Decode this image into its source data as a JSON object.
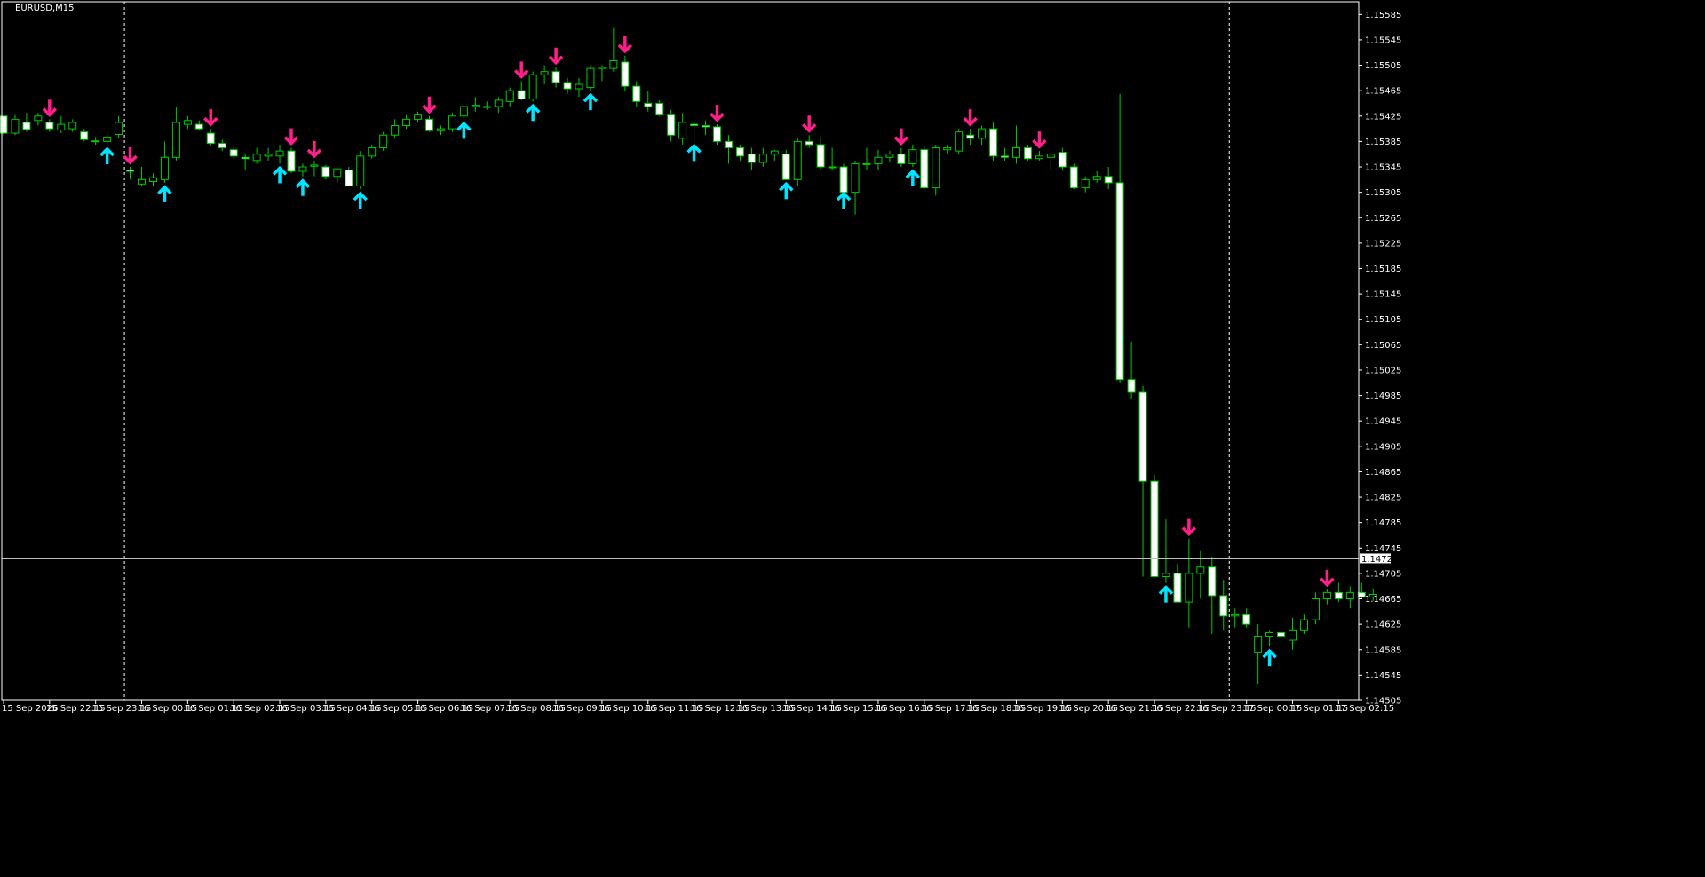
{
  "symbol_label": "EURUSD,M15",
  "current_price_label": "1.14728",
  "colors": {
    "background": "#000000",
    "candle_bull": "#000000",
    "candle_bear": "#ffffff",
    "candle_outline": "#00cc00",
    "wick": "#00cc00",
    "frame": "#ffffff",
    "text": "#ffffff",
    "arrow_buy": "#00e5ff",
    "arrow_sell": "#ff1f8a",
    "price_line": "#c0c0c0",
    "separator": "#ffffff"
  },
  "icons": {
    "buy_arrow": "arrow-up-icon",
    "sell_arrow": "arrow-down-icon"
  },
  "chart_data": {
    "type": "candlestick",
    "ylim": [
      1.14505,
      1.15605
    ],
    "y_ticks": [
      "1.15585",
      "1.15545",
      "1.15505",
      "1.15465",
      "1.15425",
      "1.15385",
      "1.15345",
      "1.15305",
      "1.15265",
      "1.15225",
      "1.15185",
      "1.15145",
      "1.15105",
      "1.15065",
      "1.15025",
      "1.14985",
      "1.14945",
      "1.14905",
      "1.14865",
      "1.14825",
      "1.14785",
      "1.14745",
      "1.14705",
      "1.14665",
      "1.14625",
      "1.14585",
      "1.14545",
      "1.14505"
    ],
    "x_ticks": [
      {
        "label": "15 Sep 2026",
        "bar": 0
      },
      {
        "label": "15 Sep 22:15",
        "bar": 4
      },
      {
        "label": "15 Sep 23:15",
        "bar": 8
      },
      {
        "label": "16 Sep 00:15",
        "bar": 12
      },
      {
        "label": "16 Sep 01:15",
        "bar": 16
      },
      {
        "label": "16 Sep 02:15",
        "bar": 20
      },
      {
        "label": "16 Sep 03:15",
        "bar": 24
      },
      {
        "label": "16 Sep 04:15",
        "bar": 28
      },
      {
        "label": "16 Sep 05:15",
        "bar": 32
      },
      {
        "label": "16 Sep 06:15",
        "bar": 36
      },
      {
        "label": "16 Sep 07:15",
        "bar": 40
      },
      {
        "label": "16 Sep 08:15",
        "bar": 44
      },
      {
        "label": "16 Sep 09:15",
        "bar": 48
      },
      {
        "label": "16 Sep 10:15",
        "bar": 52
      },
      {
        "label": "16 Sep 11:15",
        "bar": 56
      },
      {
        "label": "16 Sep 12:15",
        "bar": 60
      },
      {
        "label": "16 Sep 13:15",
        "bar": 64
      },
      {
        "label": "16 Sep 14:15",
        "bar": 68
      },
      {
        "label": "16 Sep 15:15",
        "bar": 72
      },
      {
        "label": "16 Sep 16:15",
        "bar": 76
      },
      {
        "label": "16 Sep 17:15",
        "bar": 80
      },
      {
        "label": "16 Sep 18:15",
        "bar": 84
      },
      {
        "label": "16 Sep 19:15",
        "bar": 88
      },
      {
        "label": "16 Sep 20:15",
        "bar": 92
      },
      {
        "label": "16 Sep 21:15",
        "bar": 96
      },
      {
        "label": "16 Sep 22:15",
        "bar": 100
      },
      {
        "label": "16 Sep 23:15",
        "bar": 104
      },
      {
        "label": "17 Sep 00:15",
        "bar": 108
      },
      {
        "label": "17 Sep 01:15",
        "bar": 112
      },
      {
        "label": "17 Sep 02:15",
        "bar": 116
      }
    ],
    "day_separators": [
      11,
      107
    ],
    "current_price": 1.14728,
    "ohlc": [
      [
        1.15425,
        1.15425,
        1.15395,
        1.15398
      ],
      [
        1.15398,
        1.15428,
        1.15395,
        1.1542
      ],
      [
        1.15415,
        1.1543,
        1.154,
        1.15404
      ],
      [
        1.15418,
        1.1543,
        1.1541,
        1.15425
      ],
      [
        1.15415,
        1.1542,
        1.154,
        1.15405
      ],
      [
        1.15403,
        1.15425,
        1.15398,
        1.15412
      ],
      [
        1.15405,
        1.1542,
        1.154,
        1.15415
      ],
      [
        1.154,
        1.15405,
        1.15385,
        1.15388
      ],
      [
        1.15386,
        1.15392,
        1.1538,
        1.15385
      ],
      [
        1.15385,
        1.154,
        1.1538,
        1.15392
      ],
      [
        1.15396,
        1.15425,
        1.1539,
        1.15415
      ],
      [
        1.1534,
        1.15345,
        1.15325,
        1.15338
      ],
      [
        1.15318,
        1.15345,
        1.15315,
        1.15325
      ],
      [
        1.15322,
        1.15335,
        1.15315,
        1.15328
      ],
      [
        1.15325,
        1.15385,
        1.1532,
        1.1536
      ],
      [
        1.1536,
        1.1544,
        1.15355,
        1.15415
      ],
      [
        1.15412,
        1.15425,
        1.15405,
        1.15418
      ],
      [
        1.15412,
        1.15418,
        1.15402,
        1.15405
      ],
      [
        1.15398,
        1.15405,
        1.15378,
        1.15382
      ],
      [
        1.15382,
        1.15388,
        1.1537,
        1.15375
      ],
      [
        1.15372,
        1.15378,
        1.15358,
        1.15362
      ],
      [
        1.1536,
        1.15365,
        1.1534,
        1.15358
      ],
      [
        1.15355,
        1.15375,
        1.1535,
        1.15365
      ],
      [
        1.15362,
        1.15375,
        1.15355,
        1.15365
      ],
      [
        1.15362,
        1.1538,
        1.1535,
        1.1537
      ],
      [
        1.1537,
        1.15375,
        1.15335,
        1.15338
      ],
      [
        1.15338,
        1.1535,
        1.1533,
        1.15345
      ],
      [
        1.15346,
        1.15355,
        1.1533,
        1.15348
      ],
      [
        1.15345,
        1.15348,
        1.15325,
        1.1533
      ],
      [
        1.1533,
        1.15345,
        1.1532,
        1.15342
      ],
      [
        1.1534,
        1.15345,
        1.15315,
        1.15315
      ],
      [
        1.15315,
        1.1537,
        1.1531,
        1.15362
      ],
      [
        1.15362,
        1.1538,
        1.15358,
        1.15375
      ],
      [
        1.15375,
        1.154,
        1.1537,
        1.15395
      ],
      [
        1.15395,
        1.1542,
        1.1539,
        1.1541
      ],
      [
        1.1541,
        1.15428,
        1.15405,
        1.1542
      ],
      [
        1.1542,
        1.15432,
        1.15415,
        1.15428
      ],
      [
        1.1542,
        1.15425,
        1.154,
        1.15402
      ],
      [
        1.15402,
        1.1541,
        1.15395,
        1.15405
      ],
      [
        1.15405,
        1.1543,
        1.154,
        1.15425
      ],
      [
        1.15425,
        1.15445,
        1.1542,
        1.1544
      ],
      [
        1.1544,
        1.15455,
        1.15432,
        1.15442
      ],
      [
        1.1544,
        1.15448,
        1.15435,
        1.1544
      ],
      [
        1.1544,
        1.15455,
        1.1543,
        1.1545
      ],
      [
        1.15448,
        1.1547,
        1.1544,
        1.15465
      ],
      [
        1.15465,
        1.1548,
        1.1545,
        1.15452
      ],
      [
        1.15452,
        1.15495,
        1.15448,
        1.1549
      ],
      [
        1.1549,
        1.15505,
        1.15475,
        1.15495
      ],
      [
        1.15495,
        1.15502,
        1.1547,
        1.15478
      ],
      [
        1.15478,
        1.15485,
        1.1546,
        1.15468
      ],
      [
        1.15468,
        1.15485,
        1.15455,
        1.15475
      ],
      [
        1.1547,
        1.15505,
        1.15465,
        1.155
      ],
      [
        1.155,
        1.15505,
        1.1548,
        1.15502
      ],
      [
        1.155,
        1.15565,
        1.15495,
        1.15512
      ],
      [
        1.1551,
        1.1552,
        1.15465,
        1.15472
      ],
      [
        1.15472,
        1.1548,
        1.1544,
        1.15448
      ],
      [
        1.15445,
        1.15465,
        1.15432,
        1.1544
      ],
      [
        1.15445,
        1.1545,
        1.15425,
        1.15428
      ],
      [
        1.15428,
        1.15435,
        1.15385,
        1.15395
      ],
      [
        1.1539,
        1.1543,
        1.1538,
        1.15415
      ],
      [
        1.15412,
        1.1542,
        1.15385,
        1.1541
      ],
      [
        1.1541,
        1.15418,
        1.15395,
        1.15408
      ],
      [
        1.15408,
        1.15412,
        1.1538,
        1.15385
      ],
      [
        1.15385,
        1.15395,
        1.1535,
        1.15375
      ],
      [
        1.15375,
        1.1538,
        1.15355,
        1.15362
      ],
      [
        1.15365,
        1.15375,
        1.1534,
        1.15352
      ],
      [
        1.15352,
        1.15375,
        1.15345,
        1.15365
      ],
      [
        1.15365,
        1.15372,
        1.15355,
        1.1537
      ],
      [
        1.15365,
        1.15372,
        1.15325,
        1.15325
      ],
      [
        1.15325,
        1.1539,
        1.15315,
        1.15385
      ],
      [
        1.15385,
        1.15395,
        1.15375,
        1.1538
      ],
      [
        1.1538,
        1.15392,
        1.1534,
        1.15345
      ],
      [
        1.15345,
        1.15375,
        1.1534,
        1.15345
      ],
      [
        1.15345,
        1.1535,
        1.1531,
        1.15305
      ],
      [
        1.15305,
        1.15355,
        1.1527,
        1.1535
      ],
      [
        1.1535,
        1.15375,
        1.1534,
        1.1535
      ],
      [
        1.1535,
        1.15372,
        1.1534,
        1.1536
      ],
      [
        1.1536,
        1.1537,
        1.15352,
        1.15365
      ],
      [
        1.15365,
        1.15375,
        1.15345,
        1.1535
      ],
      [
        1.1535,
        1.1538,
        1.15345,
        1.15372
      ],
      [
        1.15372,
        1.15378,
        1.1531,
        1.15312
      ],
      [
        1.15312,
        1.1538,
        1.153,
        1.15375
      ],
      [
        1.15372,
        1.1538,
        1.15365,
        1.15375
      ],
      [
        1.1537,
        1.15405,
        1.15365,
        1.154
      ],
      [
        1.15395,
        1.15405,
        1.1538,
        1.1539
      ],
      [
        1.1539,
        1.1541,
        1.1538,
        1.15405
      ],
      [
        1.15405,
        1.15415,
        1.15355,
        1.15362
      ],
      [
        1.15362,
        1.15375,
        1.15355,
        1.1536
      ],
      [
        1.1536,
        1.1541,
        1.1535,
        1.15375
      ],
      [
        1.15375,
        1.1538,
        1.15355,
        1.15358
      ],
      [
        1.15358,
        1.1537,
        1.15355,
        1.15362
      ],
      [
        1.1536,
        1.1537,
        1.1534,
        1.15365
      ],
      [
        1.15368,
        1.15375,
        1.1534,
        1.15345
      ],
      [
        1.15345,
        1.1535,
        1.1531,
        1.15312
      ],
      [
        1.15312,
        1.1533,
        1.15305,
        1.15325
      ],
      [
        1.15325,
        1.15338,
        1.1532,
        1.1533
      ],
      [
        1.1533,
        1.15345,
        1.1531,
        1.1532
      ],
      [
        1.1532,
        1.1546,
        1.15005,
        1.1501
      ],
      [
        1.1501,
        1.1507,
        1.1498,
        1.1499
      ],
      [
        1.1499,
        1.15,
        1.147,
        1.1485
      ],
      [
        1.1485,
        1.1486,
        1.147,
        1.147
      ],
      [
        1.147,
        1.1479,
        1.1469,
        1.14705
      ],
      [
        1.14705,
        1.1472,
        1.1466,
        1.1466
      ],
      [
        1.1466,
        1.1476,
        1.1462,
        1.14705
      ],
      [
        1.14705,
        1.1474,
        1.14665,
        1.14715
      ],
      [
        1.14715,
        1.1473,
        1.1461,
        1.1467
      ],
      [
        1.1467,
        1.14695,
        1.14615,
        1.14638
      ],
      [
        1.14638,
        1.1465,
        1.1462,
        1.1464
      ],
      [
        1.1464,
        1.1465,
        1.1462,
        1.14625
      ],
      [
        1.1458,
        1.14625,
        1.1453,
        1.14605
      ],
      [
        1.14605,
        1.14615,
        1.1459,
        1.14612
      ],
      [
        1.14612,
        1.1462,
        1.14595,
        1.14605
      ],
      [
        1.146,
        1.14635,
        1.14585,
        1.14615
      ],
      [
        1.14615,
        1.1464,
        1.1461,
        1.14632
      ],
      [
        1.14632,
        1.14675,
        1.14625,
        1.14665
      ],
      [
        1.14665,
        1.1468,
        1.14655,
        1.14675
      ],
      [
        1.14675,
        1.1469,
        1.1466,
        1.14665
      ],
      [
        1.14665,
        1.14685,
        1.1465,
        1.14675
      ],
      [
        1.14675,
        1.1469,
        1.14665,
        1.14668
      ],
      [
        1.14668,
        1.1468,
        1.14662,
        1.14672
      ]
    ],
    "buy_signals": [
      9,
      14,
      24,
      26,
      31,
      40,
      46,
      51,
      60,
      68,
      73,
      79,
      101,
      110
    ],
    "sell_signals": [
      4,
      11,
      18,
      25,
      27,
      37,
      45,
      48,
      54,
      62,
      70,
      78,
      84,
      90,
      103,
      115
    ]
  }
}
